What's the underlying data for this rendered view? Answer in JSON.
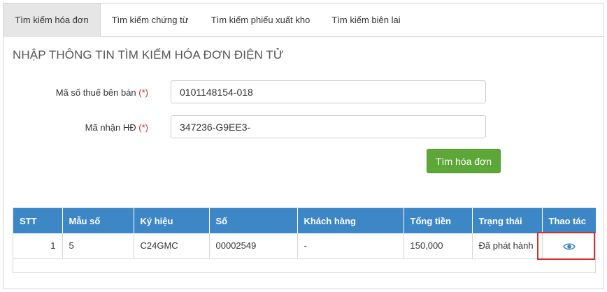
{
  "tabs": [
    {
      "label": "Tìm kiếm hóa đơn",
      "active": true
    },
    {
      "label": "Tìm kiếm chứng từ",
      "active": false
    },
    {
      "label": "Tìm kiếm phiếu xuất kho",
      "active": false
    },
    {
      "label": "Tìm kiếm biên lai",
      "active": false
    }
  ],
  "section_title": "NHẬP THÔNG TIN TÌM KIẾM HÓA ĐƠN ĐIỆN TỬ",
  "form": {
    "tax_label": "Mã số thuế bên bán",
    "tax_value": "0101148154-018",
    "code_label": "Mã nhận HĐ",
    "code_value": "347236-G9EE3-",
    "required_mark": "(*)",
    "search_button": "Tìm hóa đơn"
  },
  "table": {
    "headers": {
      "stt": "STT",
      "mau_so": "Mẫu số",
      "ky_hieu": "Ký hiệu",
      "so": "Số",
      "khach_hang": "Khách hàng",
      "tong_tien": "Tổng tiền",
      "trang_thai": "Trạng thái",
      "thao_tac": "Thao tác"
    },
    "rows": [
      {
        "stt": "1",
        "mau_so": "5",
        "ky_hieu": "C24GMC",
        "so": "00002549",
        "khach_hang": "-",
        "tong_tien": "150,000",
        "trang_thai": "Đã phát hành",
        "action_icon": "eye-icon"
      }
    ]
  },
  "colors": {
    "header_blue": "#3e87c6",
    "button_green": "#5ca738",
    "highlight_red": "#d32f2f",
    "required_red": "#c0392b"
  }
}
